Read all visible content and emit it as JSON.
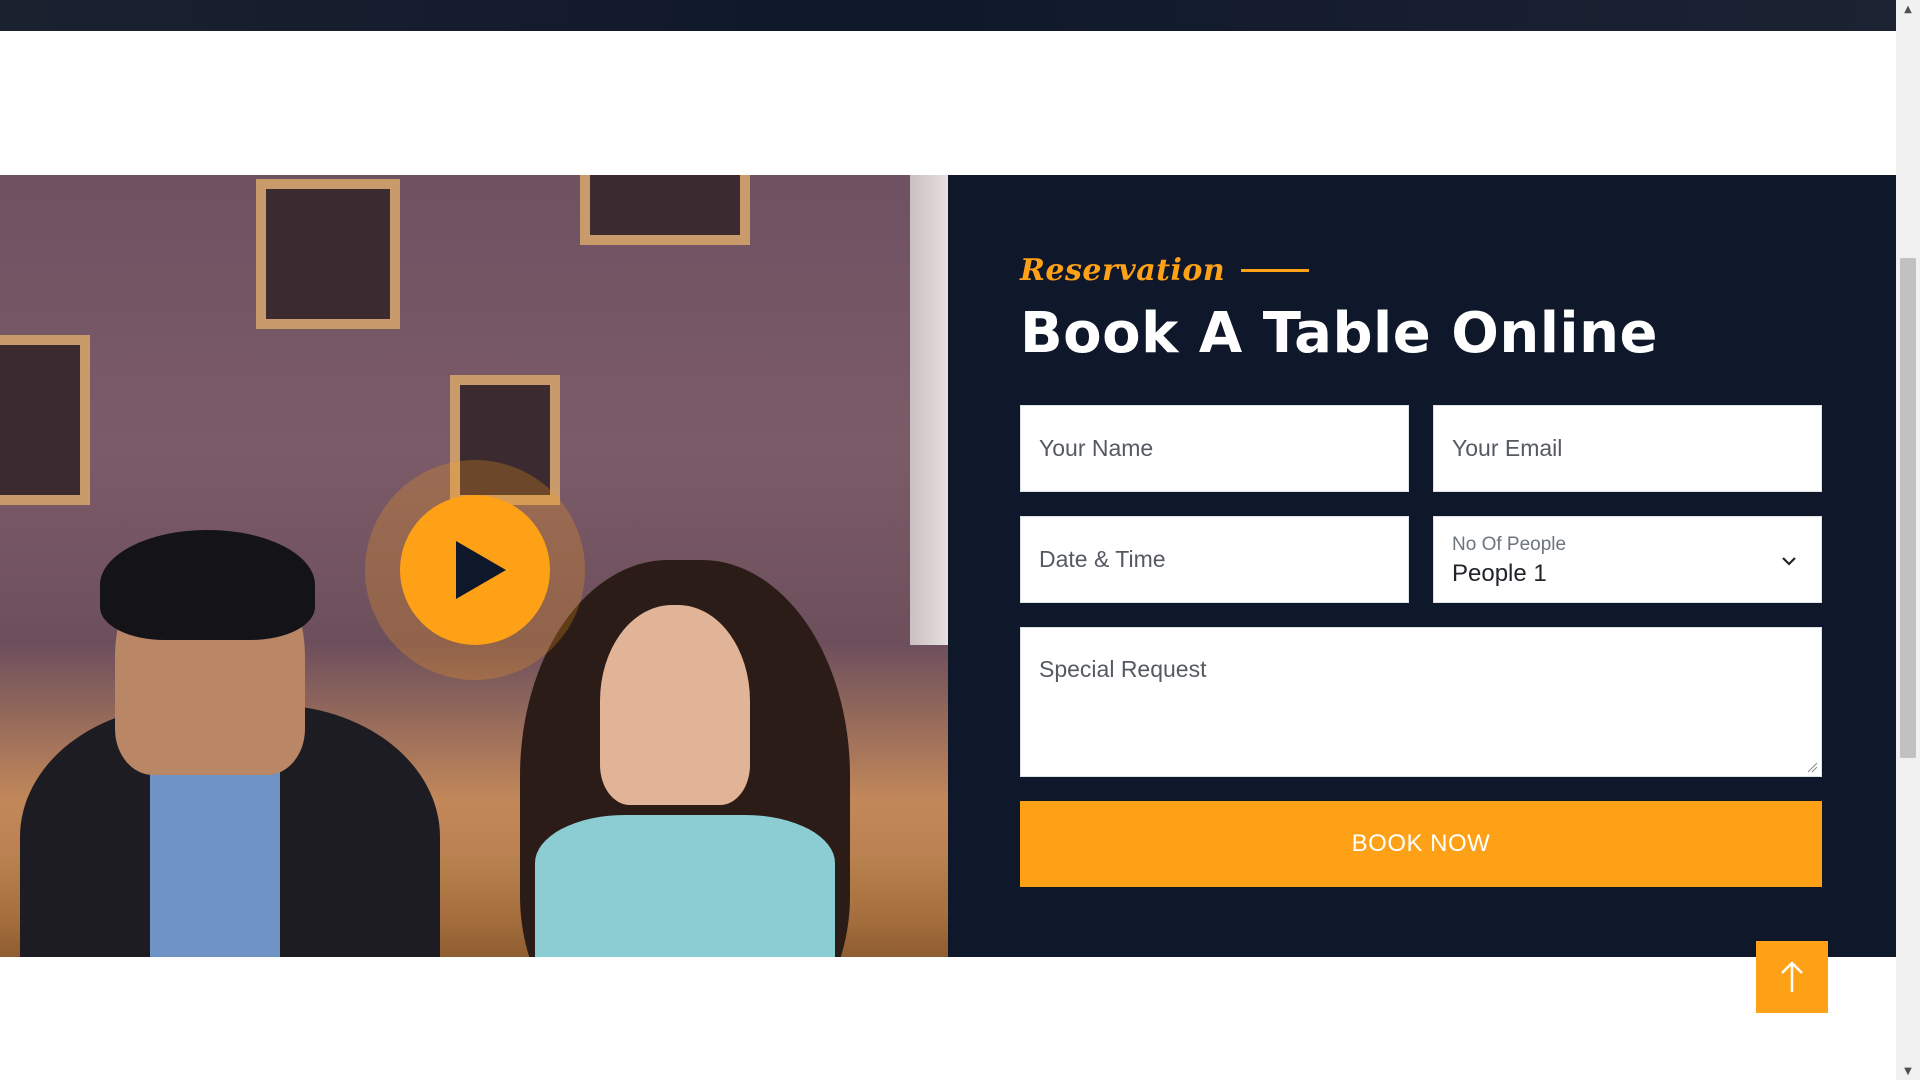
{
  "reservation": {
    "subtitle": "Reservation",
    "heading": "Book A Table Online",
    "play_icon": "play-icon",
    "form": {
      "name_placeholder": "Your Name",
      "email_placeholder": "Your Email",
      "datetime_placeholder": "Date & Time",
      "people_label": "No Of People",
      "people_value": "People 1",
      "request_placeholder": "Special Request",
      "submit_label": "BOOK NOW"
    }
  },
  "back_to_top_icon": "arrow-up-icon",
  "colors": {
    "accent": "#fea116",
    "panel": "#0f172b",
    "white": "#ffffff"
  }
}
